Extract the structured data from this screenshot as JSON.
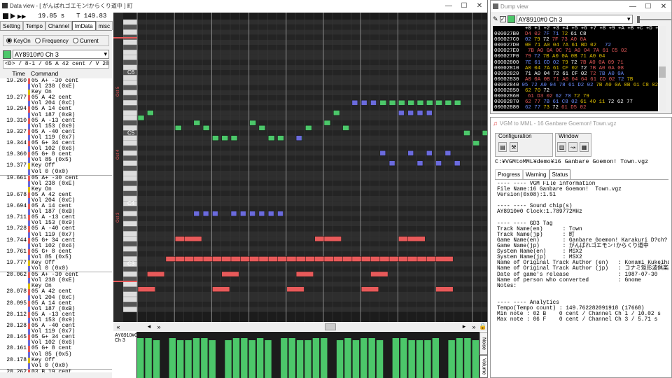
{
  "main": {
    "title": "Data view - [ がんばれゴエモン!からくり道中 ] 町",
    "time_start": "19.85 s",
    "tempo_display": "T 149.83",
    "tabs": [
      "Setting",
      "Tempo",
      "Channel",
      "ImData",
      "misc"
    ],
    "mode_options": [
      "KeyOn",
      "Frequency",
      "Current"
    ],
    "channel_select": "AY8910#0 Ch 3",
    "note_info": "<D> / 8-1 / 05 A   42 cent / V 204",
    "col_time": "Time",
    "col_command": "Command",
    "scroll_left": "◂",
    "scroll_right": "▸",
    "scroll_lleft": "«",
    "scroll_rright": "»",
    "lane_label": "AY8910#0\nCh 3",
    "side_noise": "Noise",
    "side_volume": "Volume",
    "rows": [
      {
        "t": "19.260",
        "c": "05 A+ -30 cent",
        "k": "n"
      },
      {
        "t": "",
        "c": "Vol 238 (0xE)",
        "k": "v"
      },
      {
        "t": "",
        "c": "Key On",
        "k": "k"
      },
      {
        "t": "19.277",
        "c": "05 A   42 cent",
        "k": "n"
      },
      {
        "t": "",
        "c": "Vol 204 (0xC)",
        "k": "v"
      },
      {
        "t": "19.294",
        "c": "05 A   14 cent",
        "k": "n"
      },
      {
        "t": "",
        "c": "Vol 187 (0xB)",
        "k": "v"
      },
      {
        "t": "19.310",
        "c": "05 A  -13 cent",
        "k": "n"
      },
      {
        "t": "",
        "c": "Vol 153 (0x9)",
        "k": "v"
      },
      {
        "t": "19.327",
        "c": "05 A  -40 cent",
        "k": "n"
      },
      {
        "t": "",
        "c": "Vol 119 (0x7)",
        "k": "v"
      },
      {
        "t": "19.344",
        "c": "05 G+  34 cent",
        "k": "n"
      },
      {
        "t": "",
        "c": "Vol 102 (0x6)",
        "k": "v"
      },
      {
        "t": "19.360",
        "c": "05 G+   8 cent",
        "k": "n"
      },
      {
        "t": "",
        "c": "Vol 85 (0x5)",
        "k": "v"
      },
      {
        "t": "19.377",
        "c": "Key Off",
        "k": "k"
      },
      {
        "t": "",
        "c": "Vol 0 (0x0)",
        "k": "v"
      },
      {
        "t": "19.661",
        "c": "05 A+ -30 cent",
        "k": "n"
      },
      {
        "t": "",
        "c": "Vol 238 (0xE)",
        "k": "v"
      },
      {
        "t": "",
        "c": "Key On",
        "k": "k"
      },
      {
        "t": "19.678",
        "c": "05 A   42 cent",
        "k": "n"
      },
      {
        "t": "",
        "c": "Vol 204 (0xC)",
        "k": "v"
      },
      {
        "t": "19.694",
        "c": "05 A   14 cent",
        "k": "n"
      },
      {
        "t": "",
        "c": "Vol 187 (0xB)",
        "k": "v"
      },
      {
        "t": "19.711",
        "c": "05 A  -13 cent",
        "k": "n"
      },
      {
        "t": "",
        "c": "Vol 153 (0x9)",
        "k": "v"
      },
      {
        "t": "19.728",
        "c": "05 A  -40 cent",
        "k": "n"
      },
      {
        "t": "",
        "c": "Vol 119 (0x7)",
        "k": "v"
      },
      {
        "t": "19.744",
        "c": "05 G+  34 cent",
        "k": "n"
      },
      {
        "t": "",
        "c": "Vol 102 (0x6)",
        "k": "v"
      },
      {
        "t": "19.761",
        "c": "05 G+   8 cent",
        "k": "n"
      },
      {
        "t": "",
        "c": "Vol 85 (0x5)",
        "k": "v"
      },
      {
        "t": "19.777",
        "c": "Key Off",
        "k": "k"
      },
      {
        "t": "",
        "c": "Vol 0 (0x0)",
        "k": "v"
      },
      {
        "t": "20.062",
        "c": "05 A+ -30 cent",
        "k": "n"
      },
      {
        "t": "",
        "c": "Vol 238 (0xE)",
        "k": "v"
      },
      {
        "t": "",
        "c": "Key On",
        "k": "k"
      },
      {
        "t": "20.078",
        "c": "05 A   42 cent",
        "k": "n"
      },
      {
        "t": "",
        "c": "Vol 204 (0xC)",
        "k": "v"
      },
      {
        "t": "20.095",
        "c": "05 A   14 cent",
        "k": "n"
      },
      {
        "t": "",
        "c": "Vol 187 (0xB)",
        "k": "v"
      },
      {
        "t": "20.112",
        "c": "05 A  -13 cent",
        "k": "n"
      },
      {
        "t": "",
        "c": "Vol 153 (0x9)",
        "k": "v"
      },
      {
        "t": "20.128",
        "c": "05 A  -40 cent",
        "k": "n"
      },
      {
        "t": "",
        "c": "Vol 119 (0x7)",
        "k": "v"
      },
      {
        "t": "20.145",
        "c": "05 G+  34 cent",
        "k": "n"
      },
      {
        "t": "",
        "c": "Vol 102 (0x6)",
        "k": "v"
      },
      {
        "t": "20.161",
        "c": "05 G+   8 cent",
        "k": "n"
      },
      {
        "t": "",
        "c": "Vol 85 (0x5)",
        "k": "v"
      },
      {
        "t": "20.178",
        "c": "Key Off",
        "k": "k"
      },
      {
        "t": "",
        "c": "Vol 0 (0x0)",
        "k": "v"
      },
      {
        "t": "20.262",
        "c": "03 B   19 cent",
        "k": "n"
      }
    ],
    "octave_labels": [
      "C6",
      "C5",
      "C4",
      "C3"
    ],
    "oct_side": [
      "Oct 5",
      "Oct 4",
      "Oct 3"
    ],
    "notes_green": [
      [
        0,
        19
      ],
      [
        1,
        18
      ],
      [
        4,
        21
      ],
      [
        6,
        20
      ],
      [
        7,
        21
      ],
      [
        8,
        23
      ],
      [
        9,
        23
      ],
      [
        10,
        23
      ],
      [
        12,
        20
      ],
      [
        13,
        21
      ],
      [
        14,
        23
      ],
      [
        15,
        23
      ],
      [
        17,
        23
      ],
      [
        18,
        21
      ],
      [
        20,
        20
      ],
      [
        21,
        18
      ],
      [
        22,
        21
      ],
      [
        26,
        16
      ],
      [
        27,
        16
      ],
      [
        28,
        16
      ],
      [
        29,
        16
      ],
      [
        30,
        16
      ],
      [
        31,
        16
      ],
      [
        32,
        16
      ],
      [
        33,
        16
      ],
      [
        34,
        16
      ],
      [
        35,
        22
      ],
      [
        36,
        24
      ],
      [
        37,
        22
      ],
      [
        38,
        25
      ]
    ],
    "notes_blue": [
      [
        17,
        23
      ],
      [
        23,
        16
      ],
      [
        24,
        16
      ],
      [
        25,
        16
      ],
      [
        28,
        18
      ],
      [
        29,
        18
      ],
      [
        30,
        18
      ],
      [
        31,
        18
      ],
      [
        26,
        26
      ],
      [
        29,
        26
      ],
      [
        31,
        26
      ],
      [
        33,
        26
      ],
      [
        27,
        28
      ],
      [
        30,
        28
      ],
      [
        32,
        28
      ],
      [
        34,
        28
      ],
      [
        6,
        38
      ],
      [
        7,
        38
      ],
      [
        8,
        38
      ],
      [
        10,
        38
      ],
      [
        11,
        38
      ],
      [
        12,
        38
      ],
      [
        13,
        38
      ],
      [
        14,
        38
      ],
      [
        15,
        38
      ]
    ],
    "notes_red": [
      [
        4,
        43
      ],
      [
        5,
        43
      ],
      [
        19,
        43
      ],
      [
        20,
        43
      ],
      [
        28,
        43
      ],
      [
        29,
        43
      ],
      [
        3,
        47
      ],
      [
        4,
        47
      ],
      [
        5,
        47
      ],
      [
        6,
        47
      ],
      [
        7,
        47
      ],
      [
        8,
        47
      ],
      [
        9,
        47
      ],
      [
        10,
        47
      ],
      [
        11,
        47
      ],
      [
        12,
        47
      ],
      [
        13,
        47
      ],
      [
        14,
        47
      ],
      [
        15,
        47
      ],
      [
        16,
        47
      ],
      [
        17,
        47
      ],
      [
        18,
        47
      ],
      [
        19,
        47
      ],
      [
        20,
        47
      ],
      [
        21,
        47
      ],
      [
        22,
        47
      ],
      [
        23,
        47
      ],
      [
        24,
        47
      ],
      [
        25,
        47
      ],
      [
        26,
        47
      ],
      [
        27,
        47
      ],
      [
        28,
        47
      ],
      [
        29,
        47
      ],
      [
        30,
        47
      ],
      [
        31,
        47
      ],
      [
        32,
        47
      ],
      [
        1,
        50
      ],
      [
        9,
        50
      ],
      [
        17,
        50
      ],
      [
        25,
        50
      ],
      [
        0,
        53
      ],
      [
        8,
        53
      ],
      [
        16,
        53
      ],
      [
        24,
        53
      ],
      [
        32,
        53
      ]
    ],
    "volume_bars": [
      0.95,
      0.95,
      0.9,
      0.95,
      0.95,
      0.9,
      0.9,
      0.95,
      0.95,
      0.9,
      0.9,
      0.9,
      0.95,
      0.95,
      0.9,
      0.95,
      0.9,
      0.9,
      0.95,
      0.95,
      0.9,
      0.9,
      0.95,
      0.95,
      0.95,
      0.9,
      0.95,
      0.9,
      0.95,
      0.95,
      0.9,
      0.9,
      0.95,
      0.95,
      0.9,
      0.9,
      0.9,
      0.95,
      0.95,
      0.9,
      0.95,
      0.95,
      0.9
    ]
  },
  "dump": {
    "title": "Dump view",
    "select": "AY8910#0 Ch 3",
    "header": "+0 +1 +2 +3 +4 +5 +6 +7 +8 +9 +A +B +C +D +E +F",
    "lines": [
      [
        "000027B0",
        "D4 02",
        "7F 71",
        "72",
        "61 C8"
      ],
      [
        "000027C0",
        "02",
        "79",
        "72",
        "7F 73 A0 0A"
      ],
      [
        "000027D0",
        "0E 71 A0 04 7A 61 BD 02",
        "",
        " ",
        "72"
      ],
      [
        "000027E0",
        "",
        "7B A0 0A 0C 71 A0 04 7A 61 C5 02",
        "",
        " "
      ],
      [
        "000027F0",
        "79",
        "72",
        "7B A0 0A 0B 71 A0 04",
        ""
      ],
      [
        "00002800",
        "7E 61 CD 02",
        "79",
        "72",
        "7B A0 0A 09 71"
      ],
      [
        "00002810",
        "A0 04 7A 61 CF 02",
        "72",
        "7B A0 0A 08",
        ""
      ],
      [
        "00002820",
        "71 A0 04 72 61 CF 02",
        "72",
        "7B A0 0A",
        ""
      ],
      [
        "00002830",
        "A0 0A 0B 71 A0 04 64 61 CD 02",
        "72",
        "7B",
        ""
      ],
      [
        "00002840",
        "05 72 A0 04 78 61 D2 02",
        "7B A0 0A 0B 61 C8 02",
        "",
        " "
      ],
      [
        "00002850",
        "62 70",
        "72",
        "",
        ""
      ],
      [
        "00002860",
        "",
        "61 D3 02",
        "62 70",
        "72 79"
      ],
      [
        "00002870",
        "62 77",
        "7B 61 C8 02",
        "61 40 11",
        "72 62 77"
      ],
      [
        "00002880",
        "62 77",
        "73",
        "72",
        "61 D5 02"
      ]
    ]
  },
  "vgm": {
    "title": "VGM to MML - 16 Ganbare Goemon!  Town.vgz",
    "group_config": "Configuration",
    "group_window": "Window",
    "path": "C:¥VGMtoMML¥demo¥16 Ganbare Goemon!  Town.vgz",
    "tabs": [
      "Progress",
      "Warning",
      "Status"
    ],
    "status_lines": [
      "---- ---- VGM File information",
      "File Name:16 Ganbare Goemon!  Town.vgz",
      "Version(0x08):1.51",
      "",
      "---- ---- Sound chip(s)",
      "AY8910#0 Clock:1.789772MHz",
      "",
      "---- ---- GD3 Tag",
      "Track Name(en)      : Town",
      "Track Name(jp)      : 町",
      "Game Name(en)       : Ganbare Goemon! Karakuri D?ch?",
      "Game Name(jp)       : がんばれゴエモン!からくり道中",
      "System Name(en)     : MSX2",
      "System Name(jp)     : MSX2",
      "Name of Original Track Author (en)   : Konami Kukeiha Club",
      "Name of Original Track Author (jp)   : コナミ矩形波倶楽部",
      "Date of game's release               : 1987-07-30",
      "Name of person who converted         : Gnome",
      "Notes:",
      "",
      "",
      "---- ---- Analytics",
      "Tempo(Tempo count) : 149.762282091918 (17668)",
      "Min note : 02 B    0 cent / Channel Ch 1 / 10.02 s",
      "Max note : 06 F    0 cent / Channel Ch 3 / 5.71 s"
    ]
  },
  "colors": {
    "green": "#4cc76a",
    "blue": "#6b6bdd",
    "red": "#e85a5a",
    "bg": "#1c1c1c"
  }
}
